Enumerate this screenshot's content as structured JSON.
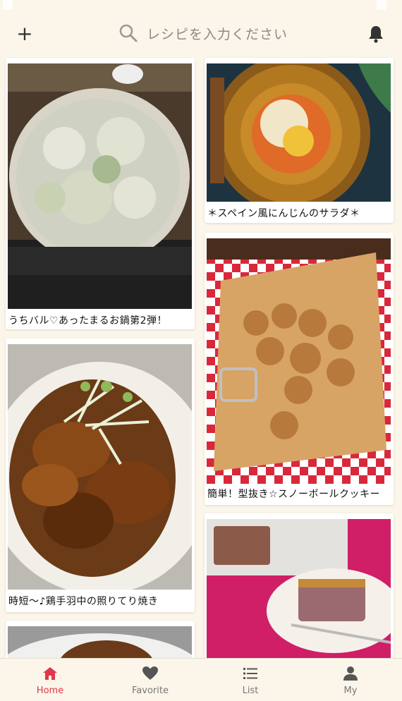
{
  "search": {
    "placeholder": "レシピを入力ください"
  },
  "recipes": [
    {
      "title": "うちバル♡あったまるお鍋第2弾！"
    },
    {
      "title": "＊スペイン風にんじんのサラダ＊"
    },
    {
      "title": "時短～♪鶏手羽中の照りてり焼き"
    },
    {
      "title": "簡単！型抜き☆スノーボールクッキー"
    },
    {
      "title": ""
    },
    {
      "title": ""
    }
  ],
  "tabs": [
    {
      "label": "Home",
      "icon": "home-icon",
      "active": true
    },
    {
      "label": "Favorite",
      "icon": "heart-icon"
    },
    {
      "label": "List",
      "icon": "list-icon"
    },
    {
      "label": "My",
      "icon": "person-icon"
    }
  ],
  "colors": {
    "accent": "#e0384b",
    "background": "#fbf6e9"
  }
}
